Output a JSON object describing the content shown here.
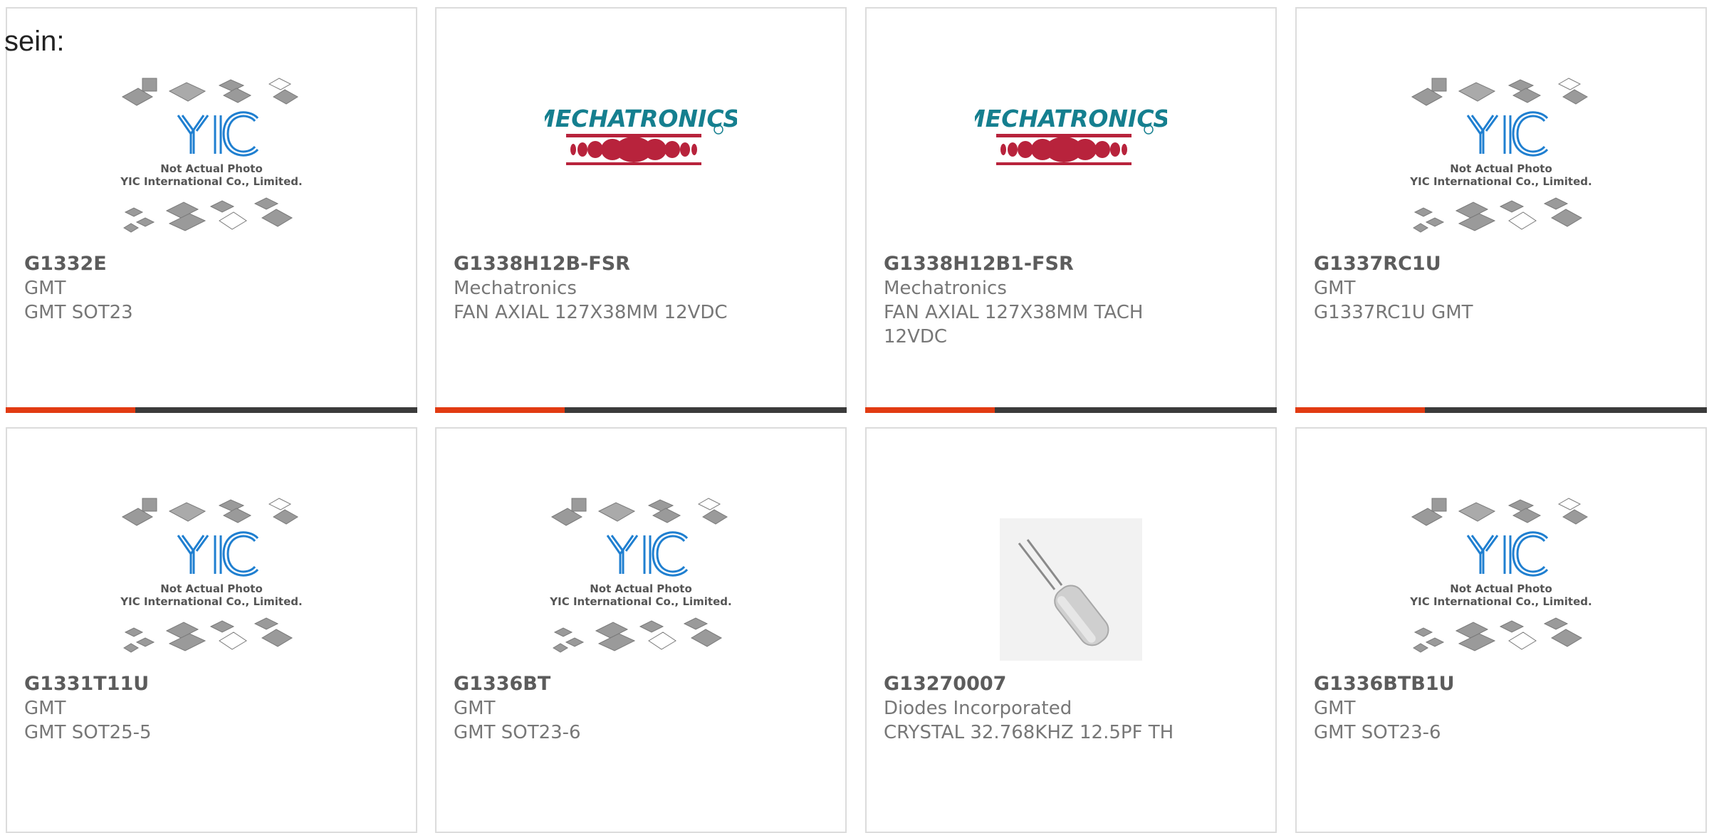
{
  "page": {
    "lead_text": "sein:"
  },
  "placeholder": {
    "line1": "Not Actual Photo",
    "line2": "YIC International Co., Limited.",
    "logo_text": "YIC"
  },
  "brand_logo": {
    "text": "MECHATRONICS"
  },
  "colors": {
    "accent": "#e23b12",
    "bar": "#3b3b3b",
    "border": "#dcdcdc",
    "logo_blue": "#1f7fd0"
  },
  "products": [
    {
      "part": "G1332E",
      "manufacturer": "GMT",
      "description": "GMT SOT23",
      "image": "yic-placeholder",
      "accent_bar": true
    },
    {
      "part": "G1338H12B-FSR",
      "manufacturer": "Mechatronics",
      "description": "FAN AXIAL 127X38MM 12VDC",
      "image": "mechatronics-logo",
      "accent_bar": true
    },
    {
      "part": "G1338H12B1-FSR",
      "manufacturer": "Mechatronics",
      "description": "FAN AXIAL 127X38MM TACH 12VDC",
      "image": "mechatronics-logo",
      "accent_bar": true
    },
    {
      "part": "G1337RC1U",
      "manufacturer": "GMT",
      "description": "G1337RC1U GMT",
      "image": "yic-placeholder",
      "accent_bar": true
    },
    {
      "part": "G1331T11U",
      "manufacturer": "GMT",
      "description": "GMT SOT25-5",
      "image": "yic-placeholder",
      "accent_bar": false
    },
    {
      "part": "G1336BT",
      "manufacturer": "GMT",
      "description": "GMT SOT23-6",
      "image": "yic-placeholder",
      "accent_bar": false
    },
    {
      "part": "G13270007",
      "manufacturer": "Diodes Incorporated",
      "description": "CRYSTAL 32.768KHZ 12.5PF TH",
      "image": "crystal-photo",
      "accent_bar": false
    },
    {
      "part": "G1336BTB1U",
      "manufacturer": "GMT",
      "description": "GMT SOT23-6",
      "image": "yic-placeholder",
      "accent_bar": false
    }
  ]
}
